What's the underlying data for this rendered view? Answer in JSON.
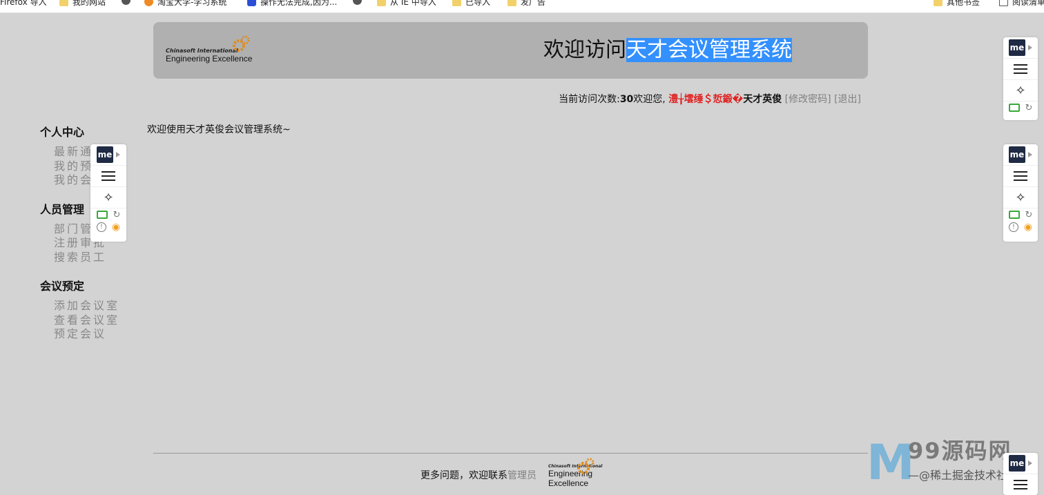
{
  "bookmarks": [
    {
      "label": "Firefox 导入",
      "icon": "none"
    },
    {
      "label": "我的网站",
      "icon": "folder-icon"
    },
    {
      "label": "",
      "icon": "globe-icon"
    },
    {
      "label": "淘宝大学-学习系统",
      "icon": "taobao-icon"
    },
    {
      "label": "操作无法完成,因为...",
      "icon": "baidu-icon"
    },
    {
      "label": "",
      "icon": "globe-icon"
    },
    {
      "label": "从 IE 中导入",
      "icon": "folder-icon"
    },
    {
      "label": "已导入",
      "icon": "folder-icon"
    },
    {
      "label": "发广告",
      "icon": "folder-icon"
    },
    {
      "label": "其他书签",
      "icon": "folder-icon"
    },
    {
      "label": "阅读清单",
      "icon": "page-icon"
    }
  ],
  "header": {
    "logo_line1": "Chinasoft International",
    "logo_line2": "Engineering Excellence",
    "title_plain": "欢迎访问",
    "title_highlight": "天才会议管理系统"
  },
  "userinfo": {
    "visits_label": "当前访问次数:",
    "visits_count": "30",
    "welcome": "欢迎您,",
    "garbled": "澧╁墵缍＄悊鍛�",
    "username": "天才英俊",
    "change_password": "[修改密码]",
    "logout": "[退出]"
  },
  "sidebar": [
    {
      "title": "个人中心",
      "items": [
        "最新通知",
        "我的预定",
        "我的会议"
      ]
    },
    {
      "title": "人员管理",
      "items": [
        "部门管理",
        "注册审批",
        "搜索员工"
      ]
    },
    {
      "title": "会议预定",
      "items": [
        "添加会议室",
        "查看会议室",
        "预定会议"
      ]
    }
  ],
  "main": {
    "welcome": "欢迎使用天才英俊会议管理系统~"
  },
  "footer": {
    "text": "更多问题，欢迎联系",
    "link": "管理员",
    "logo_line1": "Chinasoft International",
    "logo_line2": "Engineering",
    "logo_line3": "Excellence"
  },
  "extension": {
    "badge": "me"
  },
  "watermark": {
    "text": "99源码网",
    "sub": "—@稀土掘金技术社区"
  }
}
